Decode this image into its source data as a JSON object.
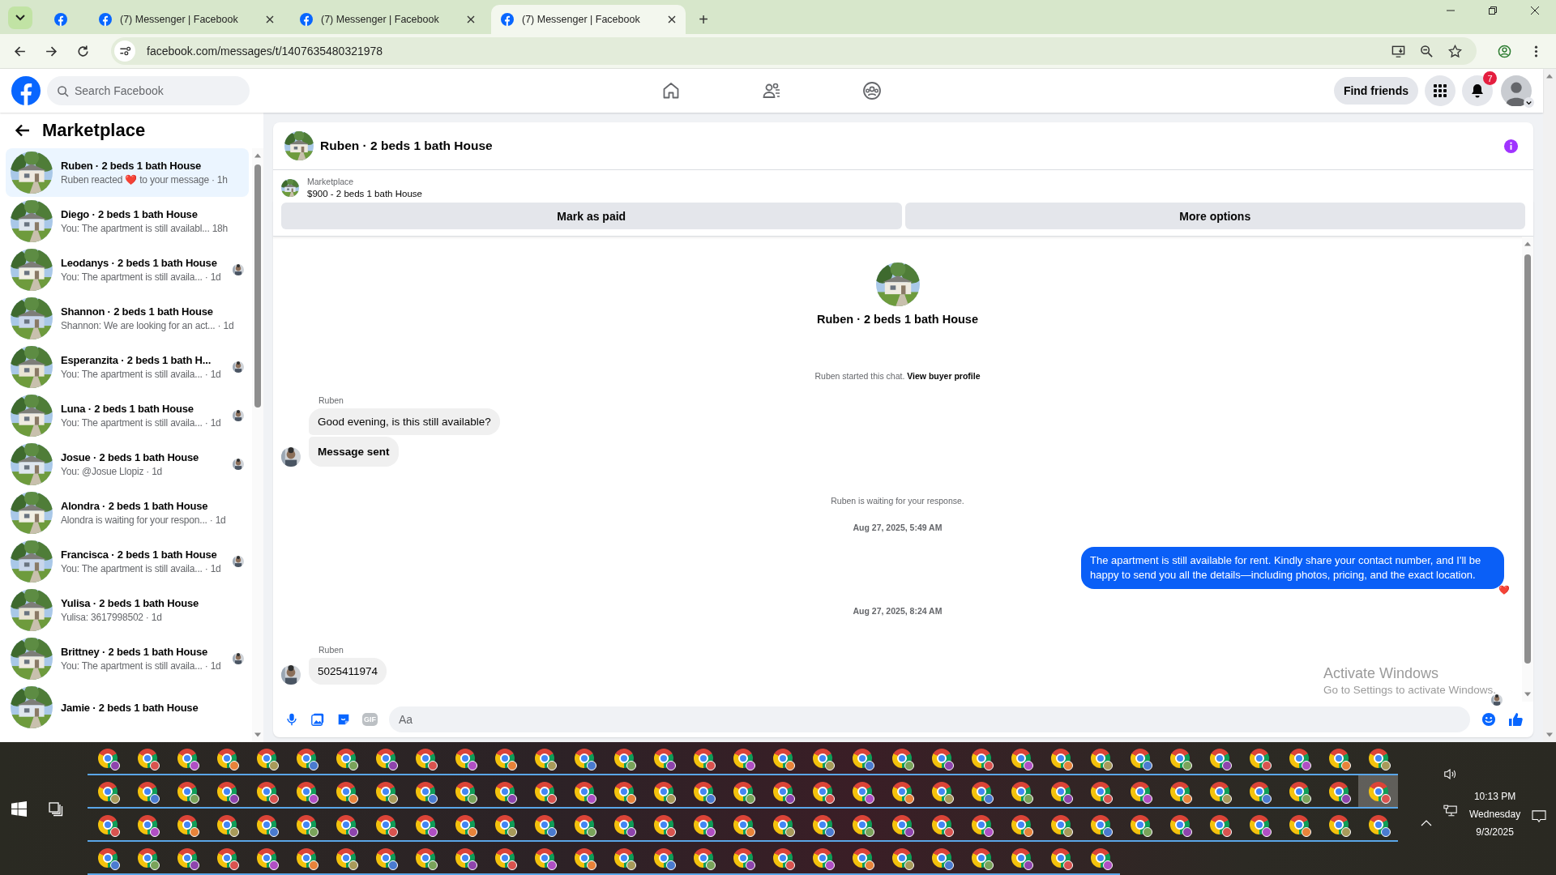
{
  "browser": {
    "tabs": [
      {
        "kind": "icon_only",
        "selected": false
      },
      {
        "kind": "titled",
        "title": "(7) Messenger | Facebook",
        "selected": false
      },
      {
        "kind": "titled",
        "title": "(7) Messenger | Facebook",
        "selected": false
      },
      {
        "kind": "titled",
        "title": "(7) Messenger | Facebook",
        "selected": true
      }
    ],
    "new_tab": "+",
    "url": "facebook.com/messages/t/1407635480321978"
  },
  "header": {
    "search_placeholder": "Search Facebook",
    "find_friends": "Find friends",
    "notifications": "7"
  },
  "sidebar": {
    "title": "Marketplace",
    "conversations": [
      {
        "title": "Ruben · 2 beds 1 bath House",
        "preview": "Ruben reacted ❤️ to your message",
        "time": "· 1h",
        "selected": true,
        "seen": false
      },
      {
        "title": "Diego · 2 beds 1 bath House",
        "preview": "You: The apartment is still availabl...",
        "time": "18h",
        "selected": false,
        "seen": false
      },
      {
        "title": "Leodanys · 2 beds 1 bath House",
        "preview": "You: The apartment is still availa...",
        "time": "· 1d",
        "selected": false,
        "seen": true
      },
      {
        "title": "Shannon · 2 beds 1 bath House",
        "preview": "Shannon: We are looking for an act...",
        "time": "· 1d",
        "selected": false,
        "seen": false
      },
      {
        "title": "Esperanzita · 2 beds 1 bath H...",
        "preview": "You: The apartment is still availa...",
        "time": "· 1d",
        "selected": false,
        "seen": true
      },
      {
        "title": "Luna · 2 beds 1 bath House",
        "preview": "You: The apartment is still availa...",
        "time": "· 1d",
        "selected": false,
        "seen": true
      },
      {
        "title": "Josue · 2 beds 1 bath House",
        "preview": "You: @Josue Llopiz",
        "time": "· 1d",
        "selected": false,
        "seen": true
      },
      {
        "title": "Alondra · 2 beds 1 bath House",
        "preview": "Alondra is waiting for your respon...",
        "time": "· 1d",
        "selected": false,
        "seen": false
      },
      {
        "title": "Francisca · 2 beds 1 bath House",
        "preview": "You: The apartment is still availa...",
        "time": "· 1d",
        "selected": false,
        "seen": true
      },
      {
        "title": "Yulisa · 2 beds 1 bath House",
        "preview": "Yulisa: 3617998502",
        "time": "· 1d",
        "selected": false,
        "seen": false
      },
      {
        "title": "Brittney · 2 beds 1 bath House",
        "preview": "You: The apartment is still availa...",
        "time": "· 1d",
        "selected": false,
        "seen": true
      },
      {
        "title": "Jamie · 2 beds 1 bath House",
        "selected": false,
        "seen": false
      }
    ]
  },
  "chat": {
    "title": "Ruben · 2 beds 1 bath House",
    "listing": {
      "label": "Marketplace",
      "title": "$900 - 2 beds 1 bath House"
    },
    "actions": [
      "Mark as paid",
      "More options"
    ],
    "intro": {
      "title": "Ruben · 2 beds 1 bath House",
      "note": "Ruben started this chat.",
      "link": "View buyer profile"
    },
    "messages": [
      {
        "kind": "sender",
        "text": "Ruben"
      },
      {
        "kind": "incoming",
        "text": "Good evening, is this still available?",
        "avatar": false,
        "bold": false
      },
      {
        "kind": "incoming",
        "text": "Message sent",
        "avatar": true,
        "bold": true
      },
      {
        "kind": "system",
        "text": "Ruben is waiting for your response."
      },
      {
        "kind": "timestamp",
        "text": "Aug 27, 2025, 5:49 AM"
      },
      {
        "kind": "outgoing",
        "text": "The apartment is still available for rent. Kindly share your contact number, and I'll be happy to send you all the details—including photos, pricing, and the exact location.",
        "reaction": "❤️"
      },
      {
        "kind": "timestamp",
        "text": "Aug 27, 2025, 8:24 AM"
      },
      {
        "kind": "sender",
        "text": "Ruben"
      },
      {
        "kind": "incoming",
        "text": "5025411974",
        "avatar": true,
        "bold": false
      }
    ],
    "composer": {
      "gif_label": "GIF",
      "placeholder": "Aa"
    }
  },
  "activation": {
    "title": "Activate Windows",
    "hint": "Go to Settings to activate Windows."
  },
  "taskbar": {
    "app_rows": [
      {
        "apps": [
          {
            "selected": false
          },
          {
            "selected": false
          },
          {
            "selected": false
          },
          {
            "selected": false
          },
          {
            "selected": false
          },
          {
            "selected": false
          },
          {
            "selected": false
          },
          {
            "selected": false
          },
          {
            "selected": false
          },
          {
            "selected": false
          },
          {
            "selected": false
          },
          {
            "selected": false
          },
          {
            "selected": false
          },
          {
            "selected": false
          },
          {
            "selected": false
          },
          {
            "selected": false
          },
          {
            "selected": false
          },
          {
            "selected": false
          },
          {
            "selected": false
          },
          {
            "selected": false
          },
          {
            "selected": false
          },
          {
            "selected": false
          },
          {
            "selected": false
          },
          {
            "selected": false
          },
          {
            "selected": false
          },
          {
            "selected": false
          },
          {
            "selected": false
          },
          {
            "selected": false
          },
          {
            "selected": false
          },
          {
            "selected": false
          },
          {
            "selected": false
          },
          {
            "selected": false
          },
          {
            "selected": false
          }
        ]
      },
      {
        "apps": [
          {
            "selected": false
          },
          {
            "selected": false
          },
          {
            "selected": false
          },
          {
            "selected": false
          },
          {
            "selected": false
          },
          {
            "selected": false
          },
          {
            "selected": false
          },
          {
            "selected": false
          },
          {
            "selected": false
          },
          {
            "selected": false
          },
          {
            "selected": false
          },
          {
            "selected": false
          },
          {
            "selected": false
          },
          {
            "selected": false
          },
          {
            "selected": false
          },
          {
            "selected": false
          },
          {
            "selected": false
          },
          {
            "selected": false
          },
          {
            "selected": false
          },
          {
            "selected": false
          },
          {
            "selected": false
          },
          {
            "selected": false
          },
          {
            "selected": false
          },
          {
            "selected": false
          },
          {
            "selected": false
          },
          {
            "selected": false
          },
          {
            "selected": false
          },
          {
            "selected": false
          },
          {
            "selected": false
          },
          {
            "selected": false
          },
          {
            "selected": false
          },
          {
            "selected": false
          },
          {
            "selected": true
          }
        ]
      },
      {
        "apps": [
          {
            "selected": false
          },
          {
            "selected": false
          },
          {
            "selected": false
          },
          {
            "selected": false
          },
          {
            "selected": false
          },
          {
            "selected": false
          },
          {
            "selected": false
          },
          {
            "selected": false
          },
          {
            "selected": false
          },
          {
            "selected": false
          },
          {
            "selected": false
          },
          {
            "selected": false
          },
          {
            "selected": false
          },
          {
            "selected": false
          },
          {
            "selected": false
          },
          {
            "selected": false
          },
          {
            "selected": false
          },
          {
            "selected": false
          },
          {
            "selected": false
          },
          {
            "selected": false
          },
          {
            "selected": false
          },
          {
            "selected": false
          },
          {
            "selected": false
          },
          {
            "selected": false
          },
          {
            "selected": false
          },
          {
            "selected": false
          },
          {
            "selected": false
          },
          {
            "selected": false
          },
          {
            "selected": false
          },
          {
            "selected": false
          },
          {
            "selected": false
          },
          {
            "selected": false
          },
          {
            "selected": false
          }
        ]
      },
      {
        "apps": [
          {
            "selected": false
          },
          {
            "selected": false
          },
          {
            "selected": false
          },
          {
            "selected": false
          },
          {
            "selected": false
          },
          {
            "selected": false
          },
          {
            "selected": false
          },
          {
            "selected": false
          },
          {
            "selected": false
          },
          {
            "selected": false
          },
          {
            "selected": false
          },
          {
            "selected": false
          },
          {
            "selected": false
          },
          {
            "selected": false
          },
          {
            "selected": false
          },
          {
            "selected": false
          },
          {
            "selected": false
          },
          {
            "selected": false
          },
          {
            "selected": false
          },
          {
            "selected": false
          },
          {
            "selected": false
          },
          {
            "selected": false
          },
          {
            "selected": false
          },
          {
            "selected": false
          },
          {
            "selected": false
          },
          {
            "selected": false
          }
        ]
      }
    ],
    "time": "10:13 PM",
    "day": "Wednesday",
    "date": "9/3/2025"
  }
}
